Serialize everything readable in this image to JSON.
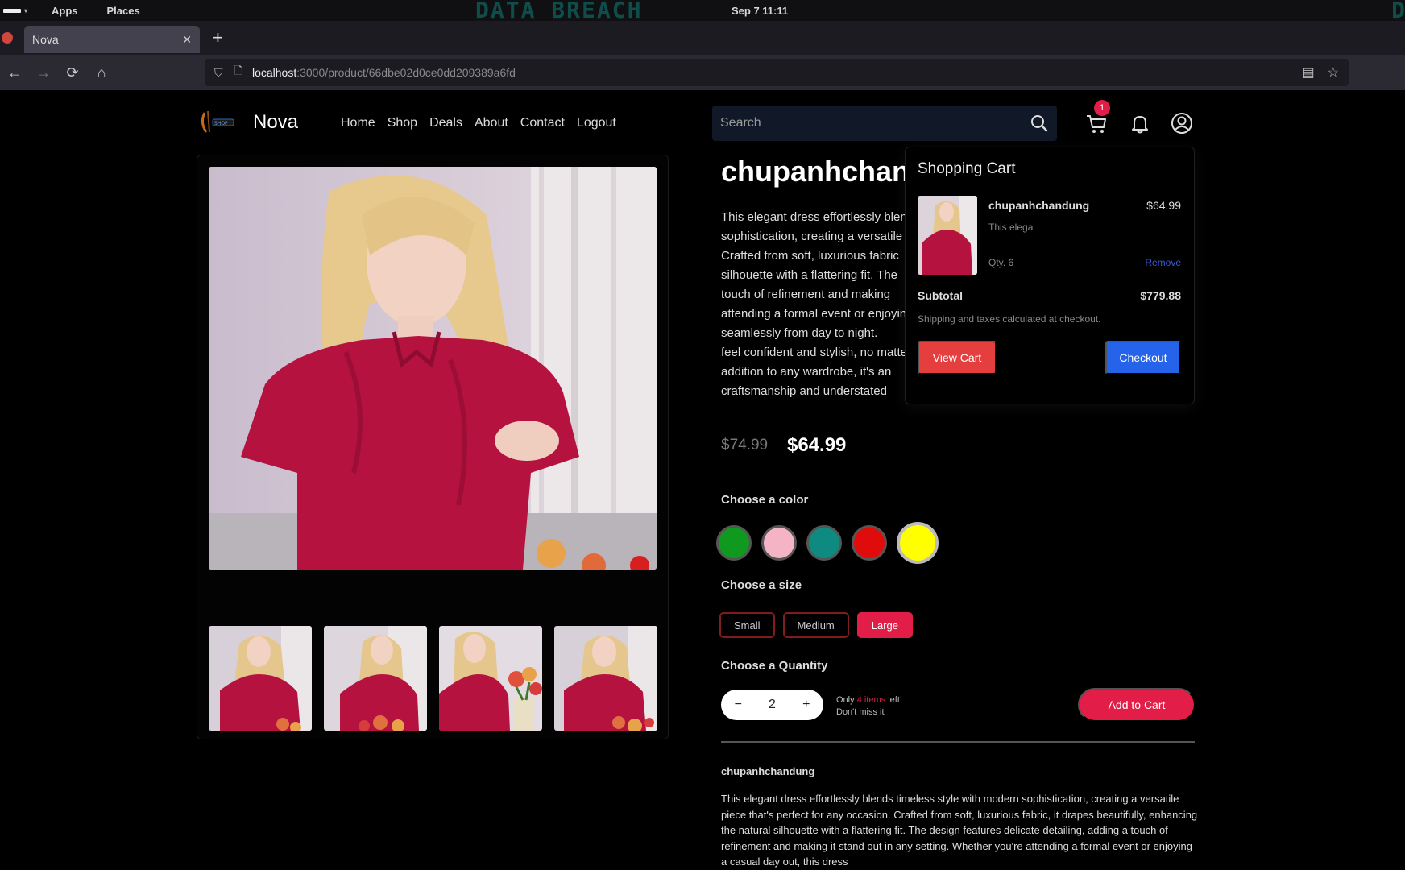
{
  "os": {
    "menu_apps": "Apps",
    "menu_places": "Places",
    "watermark": "DATA BREACH",
    "clock": "Sep 7  11:11"
  },
  "browser": {
    "tab_title": "Nova",
    "url_host": "localhost",
    "url_path": ":3000/product/66dbe02d0ce0dd209389a6fd"
  },
  "header": {
    "brand": "Nova",
    "nav": [
      "Home",
      "Shop",
      "Deals",
      "About",
      "Contact",
      "Logout"
    ],
    "search_placeholder": "Search",
    "cart_count": "1"
  },
  "product": {
    "title": "chupanhchandung",
    "short_desc_lines": [
      "This elegant dress effortlessly blends",
      "sophistication, creating a versatile",
      "Crafted from soft, luxurious fabric",
      "silhouette with a flattering fit. The",
      "touch of refinement and making",
      "attending a formal event or enjoying",
      "seamlessly from day to night.",
      "feel confident and stylish, no matter",
      "addition to any wardrobe, it's an",
      "craftsmanship and understated"
    ],
    "price_old": "$74.99",
    "price_new": "$64.99",
    "color_label": "Choose a color",
    "colors": [
      "#0f9a1f",
      "#f5b4c6",
      "#0f8a80",
      "#e00b0b",
      "#ffff00"
    ],
    "selected_color_index": 4,
    "size_label": "Choose a size",
    "sizes": [
      "Small",
      "Medium",
      "Large"
    ],
    "selected_size": "Large",
    "quantity_label": "Choose a Quantity",
    "quantity": "2",
    "qty_minus": "−",
    "qty_plus": "+",
    "stock_pre": "Only ",
    "stock_count": "4 items",
    "stock_post": " left!",
    "stock_line2": "Don't miss it",
    "add_to_cart": "Add to Cart",
    "desc_heading": "chupanhchandung",
    "description": "This elegant dress effortlessly blends timeless style with modern sophistication, creating a versatile piece that's perfect for any occasion. Crafted from soft, luxurious fabric, it drapes beautifully, enhancing the natural silhouette with a flattering fit. The design features delicate detailing, adding a touch of refinement and making it stand out in any setting. Whether you're attending a formal event or enjoying a casual day out, this dress"
  },
  "cart": {
    "title": "Shopping Cart",
    "item_name": "chupanhchandung",
    "item_price": "$64.99",
    "item_sub": "This elega",
    "item_qty": "Qty. 6",
    "remove": "Remove",
    "subtotal_label": "Subtotal",
    "subtotal_value": "$779.88",
    "note": "Shipping and taxes calculated at checkout.",
    "view_cart": "View Cart",
    "checkout": "Checkout"
  },
  "colors": {
    "accent": "#e11d48",
    "checkout_blue": "#2563eb",
    "dress": "#b5123f"
  }
}
